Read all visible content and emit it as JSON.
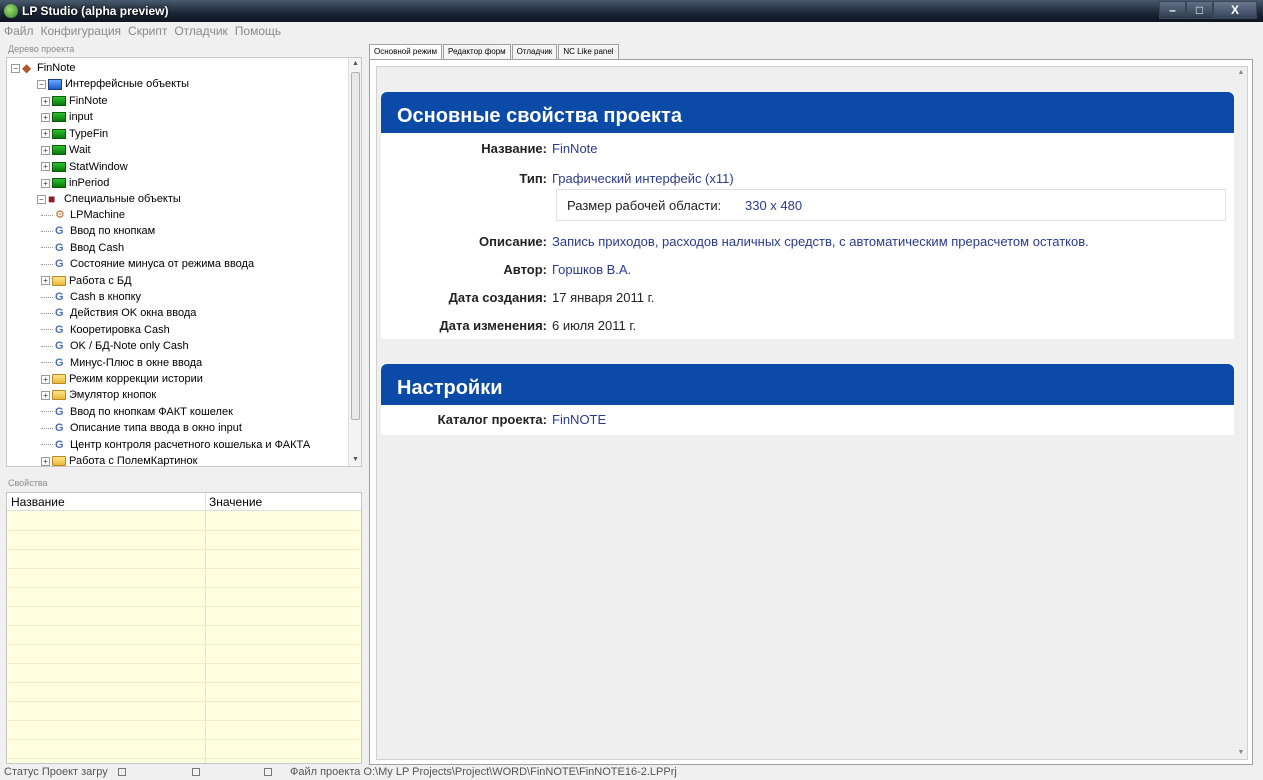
{
  "window": {
    "title": "LP Studio (alpha preview)",
    "min_glyph": "–",
    "max_glyph": "□",
    "close_glyph": "X"
  },
  "menu": [
    "Файл",
    "Конфигурация",
    "Скрипт",
    "Отладчик",
    "Помощь"
  ],
  "tree": {
    "header": "Дерево проекта",
    "root": "FinNote",
    "interface_group": "Интерфейсные объекты",
    "interface_items": [
      "FinNote",
      "input",
      "TypeFin",
      "Wait",
      "StatWindow",
      "inPeriod"
    ],
    "special_group": "Специальные объекты",
    "special_items": [
      {
        "label": "LPMachine",
        "type": "machine"
      },
      {
        "label": "Ввод по кнопкам",
        "type": "script"
      },
      {
        "label": "Ввод Cash",
        "type": "script"
      },
      {
        "label": "Состояние минуса от режима ввода",
        "type": "script"
      },
      {
        "label": "Работа с БД",
        "type": "folder"
      },
      {
        "label": "Cash в кнопку",
        "type": "script"
      },
      {
        "label": "Действия OK окна ввода",
        "type": "script"
      },
      {
        "label": "Кооретировка Cash",
        "type": "script"
      },
      {
        "label": "OK / БД-Note only Cash",
        "type": "script"
      },
      {
        "label": "Минус-Плюс в окне ввода",
        "type": "script"
      },
      {
        "label": "Режим коррекции истории",
        "type": "folder"
      },
      {
        "label": "Эмулятор кнопок",
        "type": "folder"
      },
      {
        "label": "Ввод по кнопкам ФАКТ кошелек",
        "type": "script"
      },
      {
        "label": "Описание типа ввода в окно input",
        "type": "script"
      },
      {
        "label": "Центр контроля расчетного кошелька и ФАКТА",
        "type": "script"
      },
      {
        "label": "Работа с ПолемКартинок",
        "type": "folder"
      }
    ]
  },
  "properties": {
    "header": "Свойства",
    "col_name": "Название",
    "col_value": "Значение"
  },
  "tabs": [
    "Основной режим",
    "Редактор форм",
    "Отладчик",
    "NC Like panel"
  ],
  "project": {
    "section_title": "Основные свойства проекта",
    "name_label": "Название:",
    "name_value": "FinNote",
    "type_label": "Тип:",
    "type_value": "Графический интерфейс (x11)",
    "size_label": "Размер рабочей области:",
    "size_value": "330 x 480",
    "desc_label": "Описание:",
    "desc_value": "Запись приходов, расходов наличных средств, с автоматическим прерасчетом остатков.",
    "author_label": "Автор:",
    "author_value": "Горшков В.А.",
    "created_label": "Дата создания:",
    "created_value": "17 января 2011 г.",
    "modified_label": "Дата изменения:",
    "modified_value": "6 июля 2011 г."
  },
  "settings": {
    "section_title": "Настройки",
    "catalog_label": "Каталог проекта:",
    "catalog_value": "FinNOTE"
  },
  "status": {
    "left": "Статус Проект загру",
    "file_path": "Файл проекта O:\\My LP Projects\\Project\\WORD\\FinNOTE\\FinNOTE16-2.LPPrj"
  },
  "colors": {
    "section_header": "#0b4aa6",
    "link_text": "#2a3a8f",
    "properties_bg": "#fefee0"
  }
}
